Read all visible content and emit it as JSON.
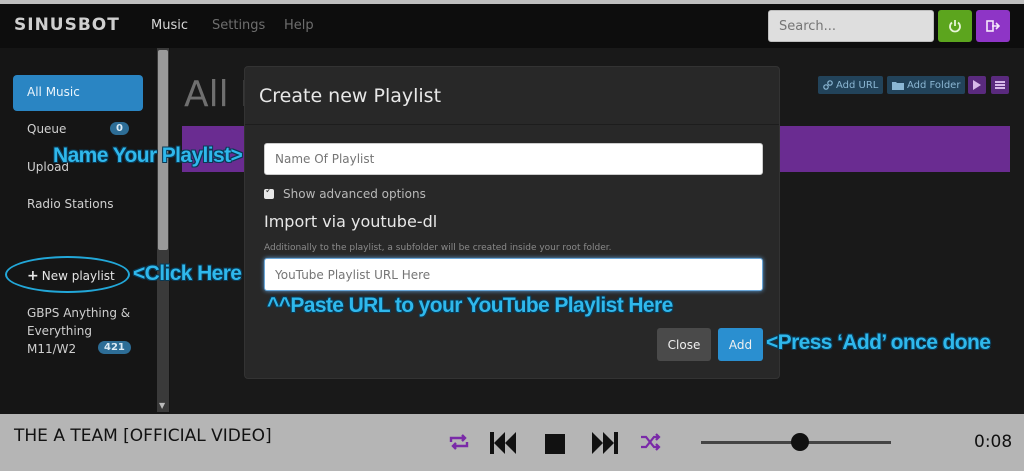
{
  "app": {
    "logo": "SINUSBOT"
  },
  "nav": {
    "items": [
      {
        "label": "Music",
        "active": true
      },
      {
        "label": "Settings",
        "active": false
      },
      {
        "label": "Help",
        "active": false
      }
    ],
    "search_placeholder": "Search..."
  },
  "sidebar": {
    "all_music": "All Music",
    "queue": "Queue",
    "queue_count": "0",
    "upload": "Upload",
    "radio": "Radio Stations",
    "new_playlist": "New playlist",
    "playlist_name": "GBPS Anything & Everything M11/W2",
    "playlist_count": "421"
  },
  "main": {
    "title": "All M",
    "add_url": "Add URL",
    "add_folder": "Add Folder"
  },
  "modal": {
    "title": "Create new Playlist",
    "name_placeholder": "Name Of Playlist",
    "advanced_label": "Show advanced options",
    "import_title": "Import via youtube-dl",
    "help_text": "Additionally to the playlist, a subfolder will be created inside your root folder.",
    "url_placeholder": "YouTube Playlist URL Here",
    "close_label": "Close",
    "add_label": "Add"
  },
  "annotations": {
    "name": "Name Your Playlist>",
    "click": "<Click Here",
    "paste": "^^Paste URL to your YouTube Playlist Here",
    "press": "<Press ‘Add’ once done"
  },
  "player": {
    "track": "THE A TEAM [OFFICIAL VIDEO]",
    "time": "0:08",
    "volume": 0.52
  },
  "colors": {
    "accent_blue": "#2a85c3",
    "accent_purple": "#8e35c6",
    "accent_green": "#5ca51e",
    "annotation": "#2fb8ec"
  }
}
